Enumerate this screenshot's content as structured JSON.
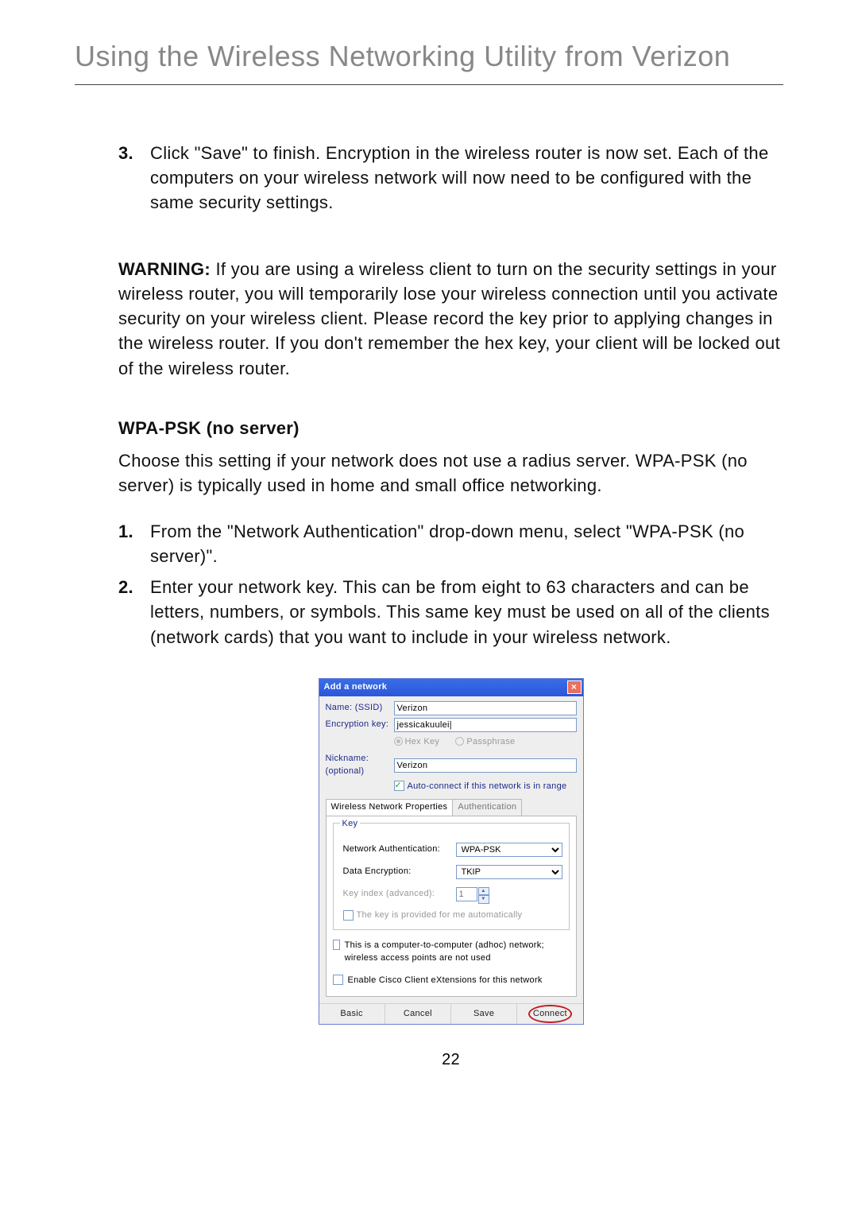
{
  "page": {
    "title": "Using the Wireless Networking Utility from Verizon",
    "number": "22"
  },
  "step3": {
    "num": "3.",
    "text": "Click \"Save\" to finish. Encryption in the wireless router is now set. Each of the computers on your wireless network will now need to be configured with the same security settings."
  },
  "warning": {
    "label": "WARNING:",
    "text": " If you are using a wireless client to turn on the security settings in your wireless router, you will temporarily lose your wireless connection until you activate security on your wireless client. Please record the key prior to applying changes in the wireless router. If you don't remember the hex key, your client will be locked out of the wireless router."
  },
  "section": {
    "title": "WPA-PSK (no server)",
    "desc": "Choose this setting if your network does not use a radius server. WPA-PSK (no server) is typically used in home and small office networking.",
    "steps": [
      {
        "num": "1.",
        "text": "From the \"Network Authentication\" drop-down menu, select \"WPA-PSK (no server)\"."
      },
      {
        "num": "2.",
        "text": "Enter your network key. This can be from eight to 63 characters and can be letters, numbers, or symbols. This same key must be used on all of the clients (network cards) that you want to include in your wireless network."
      }
    ]
  },
  "dialog": {
    "title": "Add a network",
    "labels": {
      "ssid": "Name: (SSID)",
      "enckey": "Encryption key:",
      "nickname1": "Nickname:",
      "nickname2": "(optional)",
      "hex": "Hex Key",
      "pass": "Passphrase",
      "auto": "Auto-connect if this network is in range"
    },
    "values": {
      "ssid": "Verizon",
      "enckey": "jessicakuulei|",
      "nickname": "Verizon"
    },
    "tabs": {
      "props": "Wireless Network Properties",
      "auth": "Authentication"
    },
    "key": {
      "legend": "Key",
      "netauth_lbl": "Network Authentication:",
      "netauth_val": "WPA-PSK",
      "dataenc_lbl": "Data Encryption:",
      "dataenc_val": "TKIP",
      "keyidx_lbl": "Key index (advanced):",
      "keyidx_val": "1",
      "autokey": "The key is provided for me automatically"
    },
    "opts": {
      "adhoc": "This is a computer-to-computer (adhoc) network; wireless access points are not used",
      "cisco": "Enable Cisco Client eXtensions for this network"
    },
    "buttons": {
      "basic": "Basic",
      "cancel": "Cancel",
      "save": "Save",
      "connect": "Connect"
    }
  }
}
